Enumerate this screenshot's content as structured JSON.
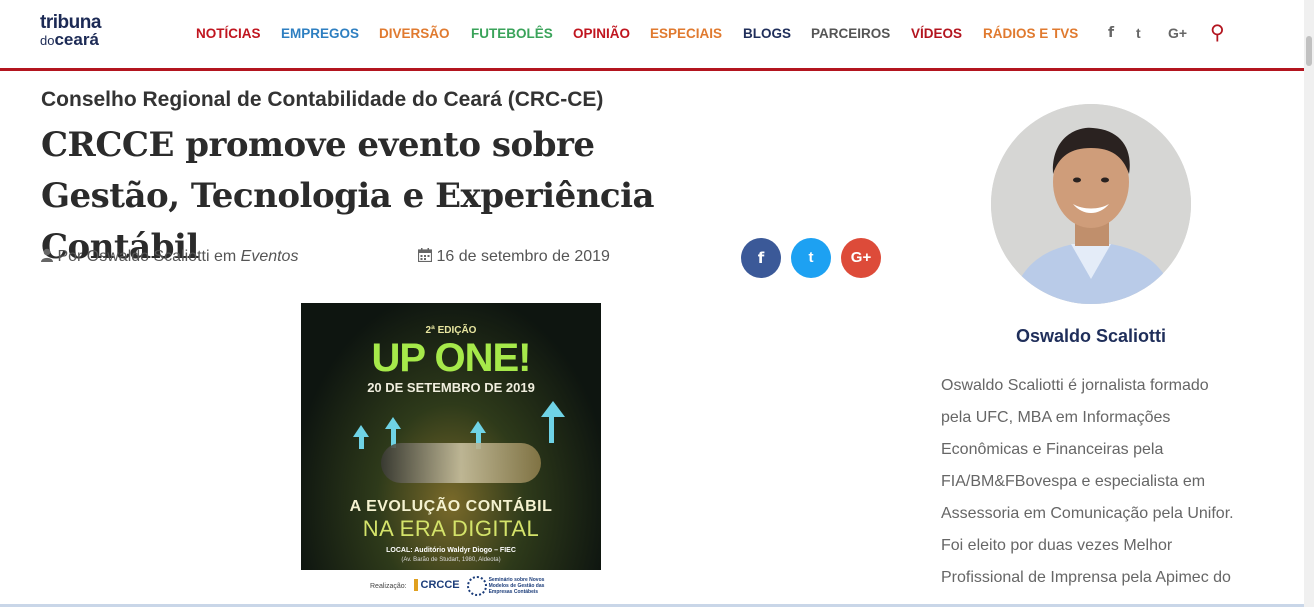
{
  "logo": {
    "line1": "tribuna",
    "line2_small": "do",
    "line2": "ceará"
  },
  "nav": {
    "items": [
      {
        "label": "NOTÍCIAS",
        "color": "#c0151f"
      },
      {
        "label": "EMPREGOS",
        "color": "#2e7fc1"
      },
      {
        "label": "DIVERSÃO",
        "color": "#e07a2f"
      },
      {
        "label": "FUTEBOLÊS",
        "color": "#3aa35a"
      },
      {
        "label": "OPINIÃO",
        "color": "#c0151f"
      },
      {
        "label": "ESPECIAIS",
        "color": "#e07a2f"
      },
      {
        "label": "BLOGS",
        "color": "#1f2e5a"
      },
      {
        "label": "PARCEIROS",
        "color": "#555555"
      },
      {
        "label": "VÍDEOS",
        "color": "#b3151f"
      },
      {
        "label": "RÁDIOS E TVS",
        "color": "#e07a2f"
      }
    ],
    "icons": [
      "facebook-icon",
      "twitter-icon",
      "google-plus-icon",
      "search-icon"
    ],
    "icon_glyphs": {
      "facebook": "f",
      "twitter": "t",
      "gplus": "G+",
      "search": "⚲"
    }
  },
  "article": {
    "category": "Conselho Regional de Contabilidade do Ceará (CRC-CE)",
    "title": "CRCCE promove evento sobre Gestão, Tecnologia e Experiência Contábil",
    "by_prefix": "Por Oswaldo Scaliotti em",
    "by_category": "Eventos",
    "date": "16 de setembro de 2019",
    "share": {
      "facebook": {
        "glyph": "f",
        "color": "#3b5998"
      },
      "twitter": {
        "glyph": "t",
        "color": "#1da1f2"
      },
      "gplus": {
        "glyph": "G+",
        "color": "#dd4b39"
      }
    }
  },
  "poster": {
    "edicao": "2ª EDIÇÃO",
    "brand": "UP ONE!",
    "date": "20 DE SETEMBRO DE 2019",
    "line1": "A EVOLUÇÃO CONTÁBIL",
    "line2": "NA ERA DIGITAL",
    "local1": "LOCAL: Auditório Waldyr Diogo – FIEC",
    "local2": "(Av. Barão de Studart, 1980, Aldeota)",
    "realizacao": "Realização:",
    "crc": "CRCCE",
    "seminar": "Seminário sobre Novos Modelos de Gestão das Empresas Contábeis"
  },
  "sidebar": {
    "author": "Oswaldo Scaliotti",
    "bio": "Oswaldo Scaliotti é jornalista formado pela UFC, MBA em Informações Econômicas e Financeiras pela FIA/BM&FBovespa e especialista em Assessoria em Comunicação pela Unifor. Foi eleito por duas vezes Melhor Profissional de Imprensa pela Apimec do"
  }
}
